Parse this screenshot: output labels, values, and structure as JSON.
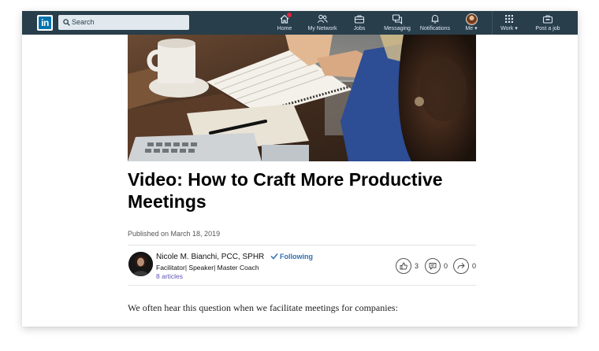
{
  "navbar": {
    "logo_text": "in",
    "search": {
      "placeholder": "Search"
    },
    "items": [
      {
        "label": "Home",
        "icon": "home-icon"
      },
      {
        "label": "My Network",
        "icon": "network-icon"
      },
      {
        "label": "Jobs",
        "icon": "briefcase-icon"
      },
      {
        "label": "Messaging",
        "icon": "messaging-icon"
      },
      {
        "label": "Notifications",
        "icon": "bell-icon"
      },
      {
        "label": "Me ▾",
        "icon": "avatar"
      },
      {
        "label": "Work ▾",
        "icon": "grid-icon"
      },
      {
        "label": "Post a job",
        "icon": "post-job-icon"
      }
    ],
    "colors": {
      "bar": "#283e4a",
      "logo": "#0073b1",
      "badge": "#e0243d"
    }
  },
  "article": {
    "hero_image": "office-meeting-photo",
    "title": "Video: How to Craft More Productive Meetings",
    "published": "Published on March 18, 2019",
    "author": {
      "name": "Nicole M. Bianchi, PCC, SPHR",
      "headline": "Facilitator| Speaker| Master Coach",
      "articles": "8 articles",
      "follow_status": "Following"
    },
    "actions": [
      {
        "icon": "like-icon",
        "count": "3"
      },
      {
        "icon": "comment-icon",
        "count": "0"
      },
      {
        "icon": "share-icon",
        "count": "0"
      }
    ],
    "body_intro": "We often hear this question when we facilitate meetings for companies:"
  }
}
